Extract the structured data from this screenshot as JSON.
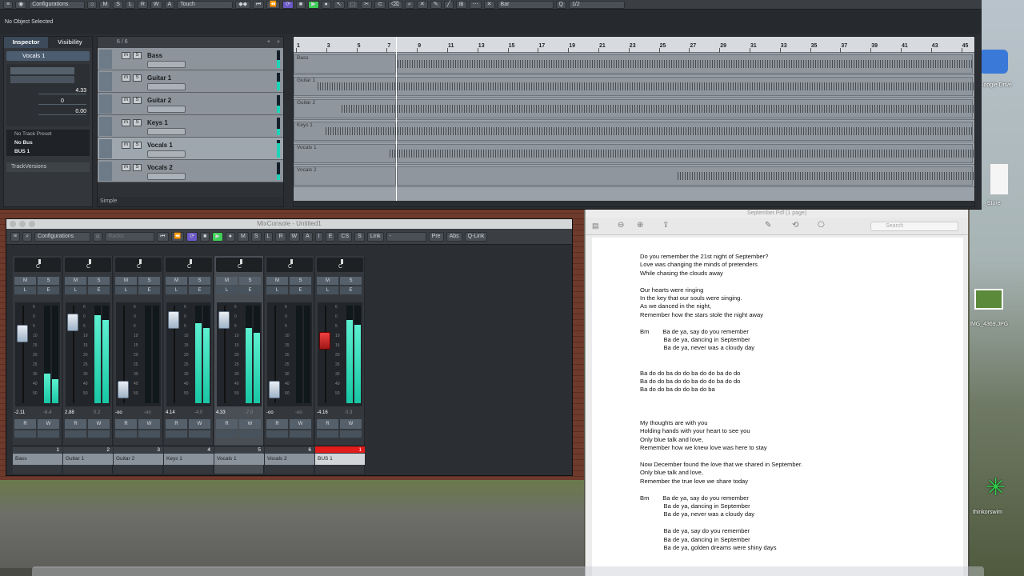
{
  "toolbar": {
    "configurations": "Configurations",
    "automation_mode": "Touch",
    "snap": "Bar",
    "quantize": "1/2",
    "msrwa": [
      "M",
      "S",
      "L",
      "R",
      "W",
      "A"
    ]
  },
  "status": {
    "text": "No Object Selected"
  },
  "inspector": {
    "tabs": [
      "Inspector",
      "Visibility"
    ],
    "track_name": "Vocals 1",
    "volume": "4.33",
    "pan": "0",
    "delay": "0.00",
    "presets": [
      "No Track Preset",
      "No Bus",
      "BUS 1"
    ],
    "track_versions": "TrackVersions"
  },
  "tracklist": {
    "count": "6 / 6",
    "footer": "Simple",
    "tracks": [
      "Bass",
      "Guitar 1",
      "Guitar 2",
      "Keys 1",
      "Vocals 1",
      "Vocals 2"
    ],
    "meter_levels": [
      0.45,
      0.5,
      0.4,
      0.35,
      0.8,
      0.3
    ]
  },
  "arrange": {
    "ruler": [
      "1",
      "3",
      "5",
      "7",
      "9",
      "11",
      "13",
      "15",
      "17",
      "19",
      "21",
      "23",
      "25",
      "27",
      "29",
      "31",
      "33",
      "35",
      "37",
      "39",
      "41",
      "43",
      "45"
    ],
    "events": [
      "Bass",
      "Guitar 1",
      "Guitar 2",
      "Keys 1",
      "Vocals 1",
      "Vocals 2"
    ]
  },
  "mixer": {
    "title": "MixConsole - Untitled1",
    "toolbar": {
      "configurations": "Configurations",
      "racks": "Racks",
      "link": "Link",
      "pre": "Pre",
      "abs": "Abs",
      "qlink": "Q-Link",
      "msrwa": [
        "M",
        "S",
        "L",
        "R",
        "W",
        "A"
      ],
      "ecs": [
        "I",
        "E",
        "CS",
        "S"
      ]
    },
    "scale": [
      "6",
      "0",
      "5",
      "10",
      "15",
      "20",
      "25",
      "30",
      "40",
      "50"
    ],
    "channels": [
      {
        "name": "Bass",
        "num": "1",
        "vol": "-2.11",
        "peak": "-6.4",
        "level": 0.3,
        "fader": 0.76
      },
      {
        "name": "Guitar 1",
        "num": "2",
        "vol": "2.88",
        "peak": "0.2",
        "level": 0.9,
        "fader": 0.9
      },
      {
        "name": "Guitar 2",
        "num": "3",
        "vol": "-oo",
        "peak": "-oo",
        "level": 0.0,
        "fader": 0.06
      },
      {
        "name": "Keys 1",
        "num": "4",
        "vol": "4.14",
        "peak": "-4.0",
        "level": 0.82,
        "fader": 0.93
      },
      {
        "name": "Vocals 1",
        "num": "5",
        "vol": "4.33",
        "peak": "-7.0",
        "level": 0.77,
        "fader": 0.93
      },
      {
        "name": "Vocals 2",
        "num": "6",
        "vol": "-oo",
        "peak": "-oo",
        "level": 0.0,
        "fader": 0.06
      },
      {
        "name": "BUS 1",
        "num": "1",
        "vol": "-4.16",
        "peak": "0.3",
        "level": 0.85,
        "fader": 0.67
      }
    ]
  },
  "pdf": {
    "title": "September.Pdf (1 page)",
    "search_placeholder": "Search",
    "lines": [
      "Do you remember the 21st night of September?",
      "Love was changing the minds of pretenders",
      "While chasing the clouds away",
      "",
      "Our hearts were ringing",
      "In the key that our souls were singing.",
      "As we danced in the night,",
      "Remember how the stars stole the night away",
      "",
      "Bm        Ba de ya, say do you remember",
      "              Ba de ya, dancing in September",
      "              Ba de ya, never was a cloudy day",
      "",
      "",
      "Ba do do ba do do ba do do ba do do",
      "Ba do do ba do do ba do do ba do do",
      "Ba do do ba do do ba do ba",
      "",
      "",
      "",
      "My thoughts are with you",
      "Holding hands with your heart to see you",
      "Only blue talk and love,",
      "Remember how we knew love was here to stay",
      "",
      "Now December found the love that we shared in September.",
      "Only blue talk and love,",
      "Remember the true love we share today",
      "",
      "Bm        Ba de ya, say do you remember",
      "              Ba de ya, dancing in September",
      "              Ba de ya, never was a cloudy day",
      "",
      "              Ba de ya, say do you remember",
      "              Ba de ya, dancing in September",
      "              Ba de ya, golden dreams were shiny days"
    ]
  },
  "desktop": {
    "google_drive": "Google Drive",
    "store": "_Store",
    "img": "IMG_4369.JPG",
    "tos": "thinkorswim"
  }
}
